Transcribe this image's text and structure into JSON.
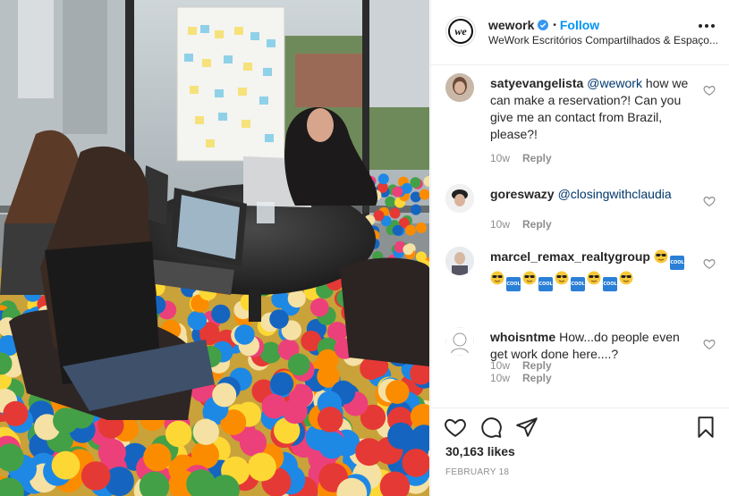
{
  "post": {
    "username": "wework",
    "follow_label": "Follow",
    "dot": "•",
    "location": "WeWork Escritórios Compartilhados & Espaço...",
    "logo_text": "we"
  },
  "comments": [
    {
      "username": "satyevangelista",
      "mention": "@wework",
      "text": " how we can make a reservation?! Can you give me an contact from Brazil, please?!",
      "time": "10w",
      "reply_label": "Reply"
    },
    {
      "username": "goreswazy",
      "mention": "@closingwithclaudia",
      "text": "",
      "time": "10w",
      "reply_label": "Reply"
    },
    {
      "username": "marcel_remax_realtygroup",
      "emoji_sequence": [
        "sunglasses-face",
        "cool-button",
        "sunglasses-face",
        "cool-button",
        "sunglasses-face",
        "cool-button",
        "sunglasses-face",
        "cool-button",
        "sunglasses-face",
        "cool-button",
        "sunglasses-face"
      ],
      "cool_text": "COOL",
      "time": "10w",
      "reply_label": "Reply"
    },
    {
      "username": "whoisntme",
      "text": "How...do people even get work done here....?",
      "time": "10w",
      "reply_label": "Reply"
    }
  ],
  "footer": {
    "likes": "30,163 likes",
    "date": "FEBRUARY 18"
  },
  "icons": {
    "like": "heart-icon",
    "comment": "comment-bubble-icon",
    "share": "paper-plane-icon",
    "save": "bookmark-icon",
    "more": "more-options-icon",
    "verified": "verified-badge-icon"
  },
  "colors": {
    "follow": "#0095f6",
    "verified": "#3897f0",
    "muted": "#8e8e8e",
    "text": "#262626",
    "border": "#efefef"
  }
}
